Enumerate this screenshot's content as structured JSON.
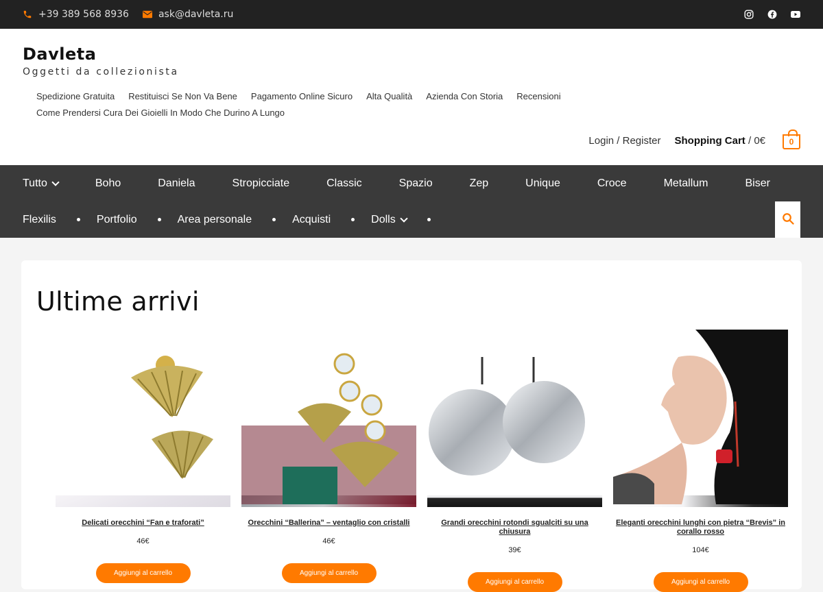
{
  "topbar": {
    "phone": "+39 389 568 8936",
    "email": "ask@davleta.ru",
    "social_icons": [
      "instagram-icon",
      "facebook-icon",
      "youtube-icon"
    ]
  },
  "header": {
    "site_title": "Davleta",
    "tagline": "Oggetti da collezionista",
    "toplinks": [
      "Spedizione Gratuita",
      "Restituisci Se Non Va Bene",
      "Pagamento Online Sicuro",
      "Alta Qualità",
      "Azienda Con Storia",
      "Recensioni",
      "Come Prendersi Cura Dei Gioielli In Modo Che Durino A Lungo"
    ],
    "login": "Login / Register",
    "cart_label": "Shopping Cart",
    "cart_total": " / 0€",
    "cart_count": "0"
  },
  "nav": {
    "row1": [
      "Tutto",
      "Boho",
      "Daniela",
      "Stropicciate",
      "Classic",
      "Spazio",
      "Zep",
      "Unique",
      "Croce",
      "Metallum",
      "Biser"
    ],
    "row2": [
      "Flexilis",
      "Portfolio",
      "Area personale",
      "Acquisti",
      "Dolls"
    ]
  },
  "section": {
    "title": "Ultime arrivi",
    "add_to_cart": "Aggiungi al carrello"
  },
  "products": [
    {
      "name": "Delicati orecchini “Fan e traforati”",
      "price": "46€"
    },
    {
      "name": "Orecchini “Ballerina” – ventaglio con cristalli",
      "price": "46€"
    },
    {
      "name": "Grandi orecchini rotondi sgualciti su una chiusura",
      "price": "39€"
    },
    {
      "name": "Eleganti orecchini lunghi con pietra “Brevis” in corallo rosso",
      "price": "104€"
    }
  ],
  "colors": {
    "accent": "#ff7a00",
    "topbar": "#222222",
    "nav": "#3a3a3a"
  }
}
